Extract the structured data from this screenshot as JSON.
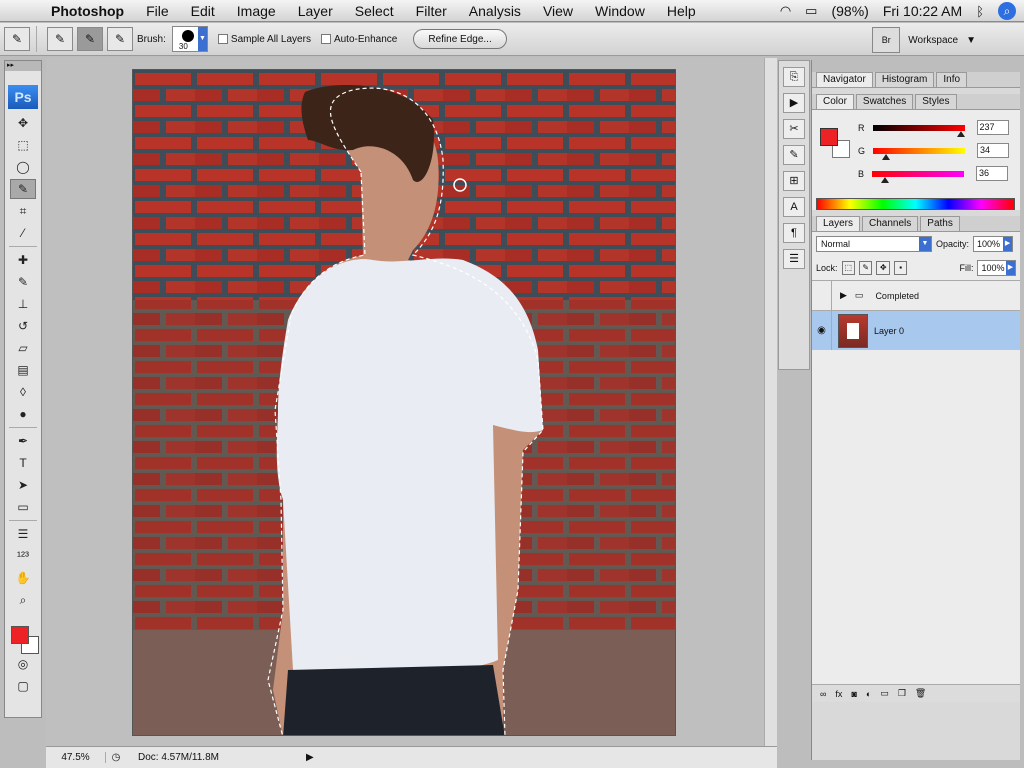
{
  "menubar": {
    "app": "Photoshop",
    "items": [
      "File",
      "Edit",
      "Image",
      "Layer",
      "Select",
      "Filter",
      "Analysis",
      "View",
      "Window",
      "Help"
    ],
    "battery": "(98%)",
    "clock": "Fri 10:22 AM"
  },
  "options": {
    "brush_label": "Brush:",
    "brush_size": "30",
    "sample_all_layers": "Sample All Layers",
    "auto_enhance": "Auto-Enhance",
    "refine_edge": "Refine Edge...",
    "workspace": "Workspace"
  },
  "toolbar": {
    "logo": "Ps"
  },
  "canvas": {
    "zoom": "47.5%",
    "doc": "Doc: 4.57M/11.8M"
  },
  "panels": {
    "nav_tabs": [
      "Navigator",
      "Histogram",
      "Info"
    ],
    "color_tabs": [
      "Color",
      "Swatches",
      "Styles"
    ],
    "color": {
      "r_label": "R",
      "r_value": "237",
      "g_label": "G",
      "g_value": "34",
      "b_label": "B",
      "b_value": "36",
      "fg_hex": "#ed2224"
    },
    "layer_tabs": [
      "Layers",
      "Channels",
      "Paths"
    ],
    "blend_mode": "Normal",
    "opacity_label": "Opacity:",
    "opacity_value": "100%",
    "lock_label": "Lock:",
    "fill_label": "Fill:",
    "fill_value": "100%",
    "layers": [
      {
        "name": "Completed",
        "type": "group"
      },
      {
        "name": "Layer 0",
        "type": "pixel",
        "selected": true
      }
    ]
  }
}
